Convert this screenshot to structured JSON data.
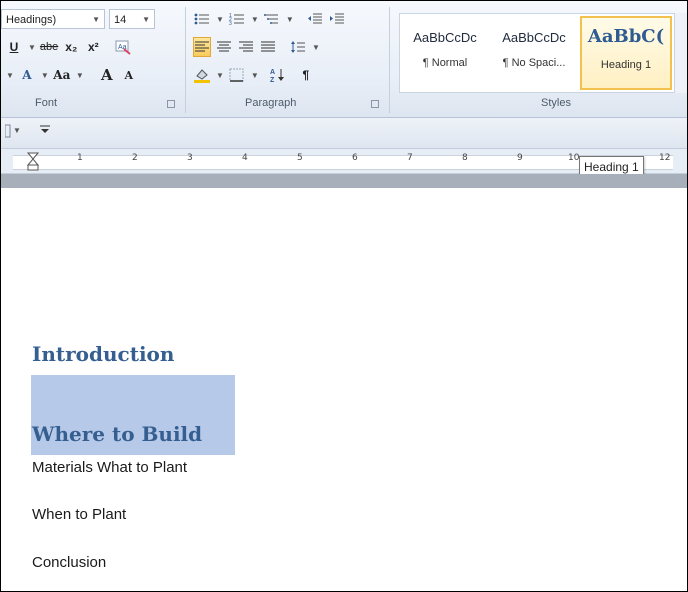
{
  "ribbon": {
    "font": {
      "font_name": "Headings)",
      "font_size": "14",
      "underline": "U",
      "strikethrough": "abe",
      "subscript": "x₂",
      "superscript": "x²",
      "font_color": "A",
      "change_case": "Aa",
      "grow_font": "A",
      "shrink_font": "A",
      "label": "Font"
    },
    "paragraph": {
      "show_marks": "¶",
      "label": "Paragraph"
    },
    "styles": {
      "label": "Styles",
      "tiles": [
        {
          "sample": "AaBbCcDc",
          "name": "¶ Normal"
        },
        {
          "sample": "AaBbCcDc",
          "name": "¶ No Spaci..."
        },
        {
          "sample": "AaBbC(",
          "name": "Heading 1"
        }
      ]
    }
  },
  "ruler": {
    "ticks": [
      "1",
      "2",
      "3",
      "4",
      "5",
      "6",
      "7",
      "8",
      "9",
      "10",
      "12"
    ],
    "tooltip": "Heading 1"
  },
  "document": {
    "heading1": "Introduction",
    "heading2": "Where to Build",
    "lines": [
      "Materials What to Plant",
      "When to Plant",
      "Conclusion"
    ]
  },
  "colors": {
    "heading": "#365f91",
    "selection": "#b7c9e8",
    "selected_style_border": "#f2c14e"
  }
}
